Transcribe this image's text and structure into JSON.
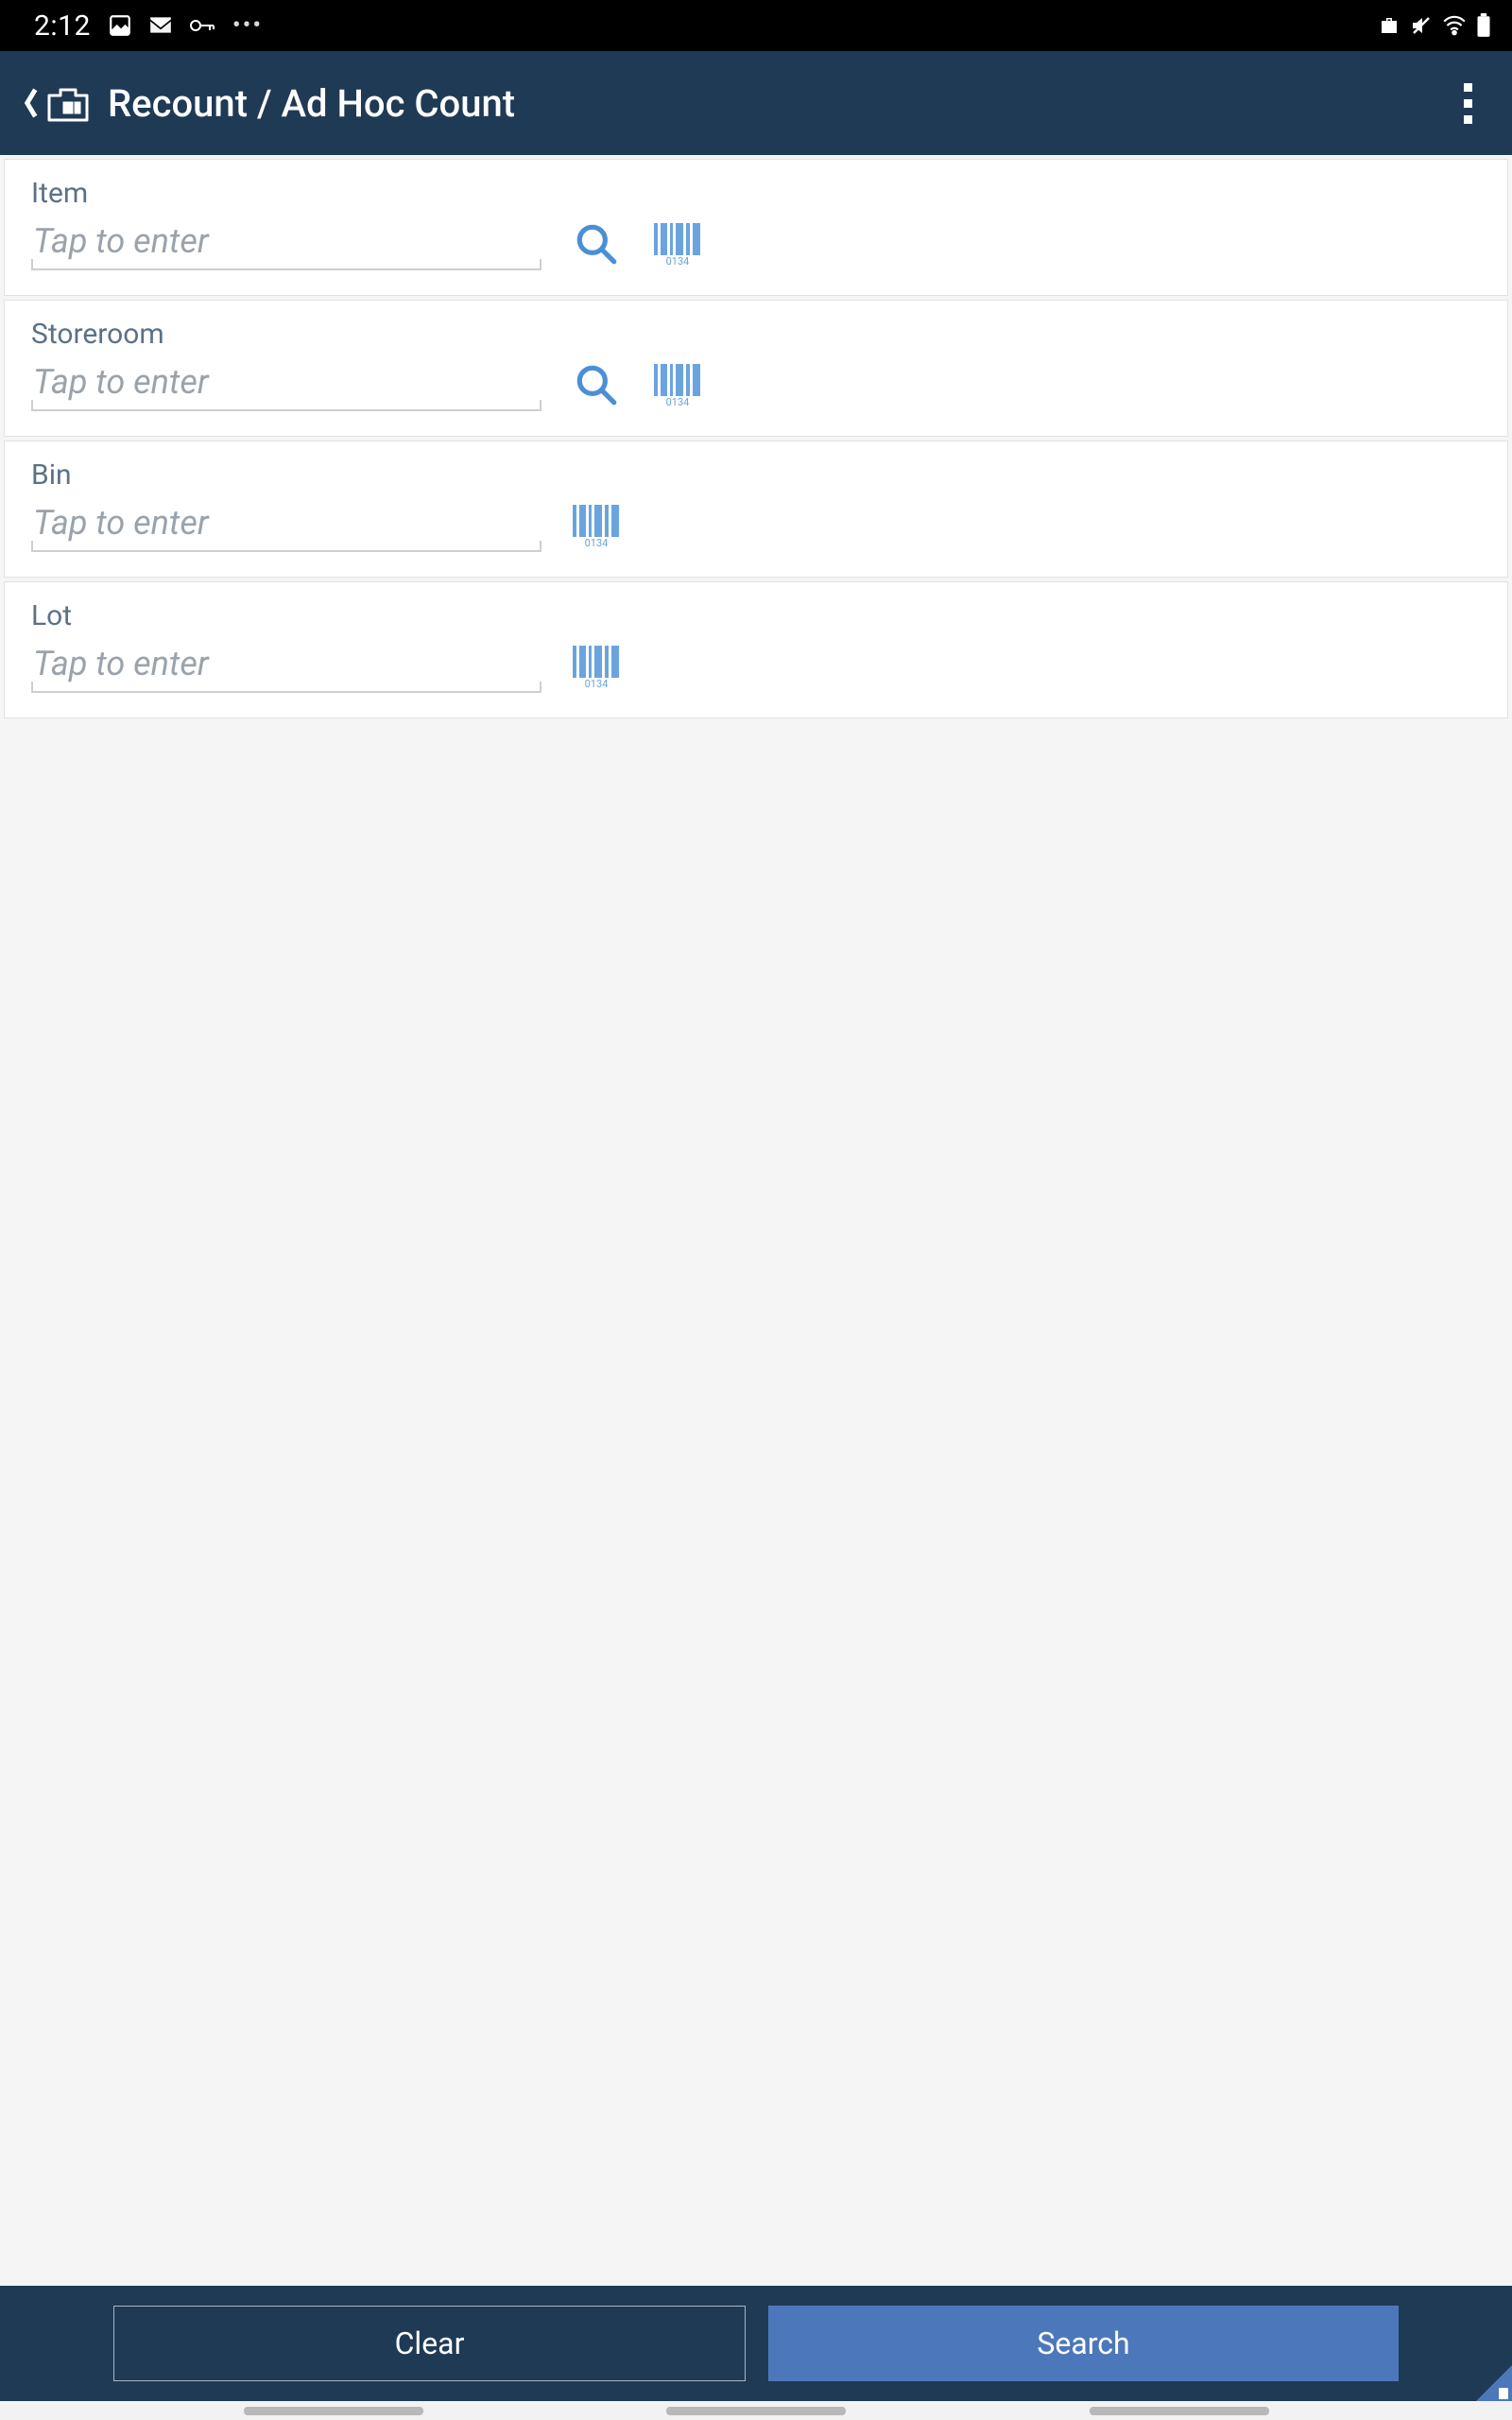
{
  "status": {
    "time": "2:12"
  },
  "header": {
    "title": "Recount / Ad Hoc Count"
  },
  "fields": {
    "item": {
      "label": "Item",
      "placeholder": "Tap to enter",
      "value": ""
    },
    "storeroom": {
      "label": "Storeroom",
      "placeholder": "Tap to enter",
      "value": ""
    },
    "bin": {
      "label": "Bin",
      "placeholder": "Tap to enter",
      "value": ""
    },
    "lot": {
      "label": "Lot",
      "placeholder": "Tap to enter",
      "value": ""
    }
  },
  "footer": {
    "clear_label": "Clear",
    "search_label": "Search"
  },
  "barcode_code": "0134"
}
